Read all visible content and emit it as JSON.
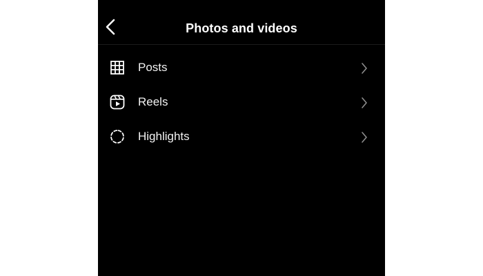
{
  "header": {
    "title": "Photos and videos",
    "back_icon": "chevron-left-icon"
  },
  "menu": {
    "items": [
      {
        "label": "Posts",
        "icon": "grid-icon"
      },
      {
        "label": "Reels",
        "icon": "reels-icon"
      },
      {
        "label": "Highlights",
        "icon": "highlights-icon"
      }
    ]
  },
  "colors": {
    "background": "#000000",
    "page": "#ffffff",
    "text": "#ffffff",
    "chevron": "#8e8e8e"
  }
}
